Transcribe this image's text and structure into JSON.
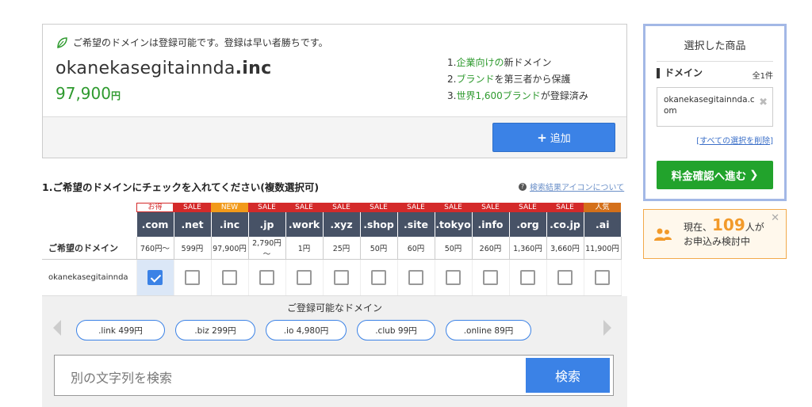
{
  "result": {
    "available_text": "ご希望のドメインは登録可能です。登録は早い者勝ちです。",
    "domain_base": "okanekasegitainnda",
    "domain_tld": ".inc",
    "price": "97,900",
    "price_unit": "円",
    "points": [
      {
        "num": "1.",
        "green": "企業向けの",
        "text": "新ドメイン"
      },
      {
        "num": "2.",
        "green": "ブランド",
        "text": "を第三者から保護"
      },
      {
        "num": "3.",
        "green": "世界1,600ブランド",
        "text": "が登録済み"
      }
    ],
    "add_button": "追加"
  },
  "section": {
    "title": "1.ご希望のドメインにチェックを入れてください(複数選択可)",
    "help_link": "検索結果アイコンについて"
  },
  "table": {
    "label_header": "ご希望のドメイン",
    "row_label": "okanekasegitainnda",
    "tlds": [
      {
        "badge": "お得",
        "badge_color": "#ffffff",
        "name": ".com",
        "price": "760円～",
        "checked": true
      },
      {
        "badge": "SALE",
        "badge_color": "#d42a2a",
        "name": ".net",
        "price": "599円",
        "checked": false
      },
      {
        "badge": "NEW",
        "badge_color": "#f29a1a",
        "name": ".inc",
        "price": "97,900円",
        "checked": false
      },
      {
        "badge": "SALE",
        "badge_color": "#d42a2a",
        "name": ".jp",
        "price": "2,790円～",
        "checked": false
      },
      {
        "badge": "SALE",
        "badge_color": "#d42a2a",
        "name": ".work",
        "price": "1円",
        "checked": false
      },
      {
        "badge": "SALE",
        "badge_color": "#d42a2a",
        "name": ".xyz",
        "price": "25円",
        "checked": false
      },
      {
        "badge": "SALE",
        "badge_color": "#d42a2a",
        "name": ".shop",
        "price": "50円",
        "checked": false
      },
      {
        "badge": "SALE",
        "badge_color": "#d42a2a",
        "name": ".site",
        "price": "60円",
        "checked": false
      },
      {
        "badge": "SALE",
        "badge_color": "#d42a2a",
        "name": ".tokyo",
        "price": "50円",
        "checked": false
      },
      {
        "badge": "SALE",
        "badge_color": "#d42a2a",
        "name": ".info",
        "price": "260円",
        "checked": false
      },
      {
        "badge": "SALE",
        "badge_color": "#d42a2a",
        "name": ".org",
        "price": "1,360円",
        "checked": false
      },
      {
        "badge": "SALE",
        "badge_color": "#d42a2a",
        "name": ".co.jp",
        "price": "3,660円",
        "checked": false
      },
      {
        "badge": "人気",
        "badge_color": "#d4701a",
        "name": ".ai",
        "price": "11,900円",
        "checked": false
      }
    ]
  },
  "alternatives": {
    "title": "ご登録可能なドメイン",
    "pills": [
      ".link 499円",
      ".biz 299円",
      ".io 4,980円",
      ".club 99円",
      ".online 89円"
    ]
  },
  "search": {
    "placeholder": "別の文字列を検索",
    "button": "検索"
  },
  "cart": {
    "title": "選択した商品",
    "category": "ドメイン",
    "count": "全1件",
    "item": "okanekasegitainnda.com",
    "clear": "すべての選択を削除",
    "proceed": "料金確認へ進む"
  },
  "notice": {
    "prefix": "現在、",
    "count": "109",
    "suffix": "人が",
    "line2": "お申込み検討中"
  },
  "colors": {
    "accent": "#3b82e6",
    "green": "#22a32c",
    "header": "#475266"
  }
}
